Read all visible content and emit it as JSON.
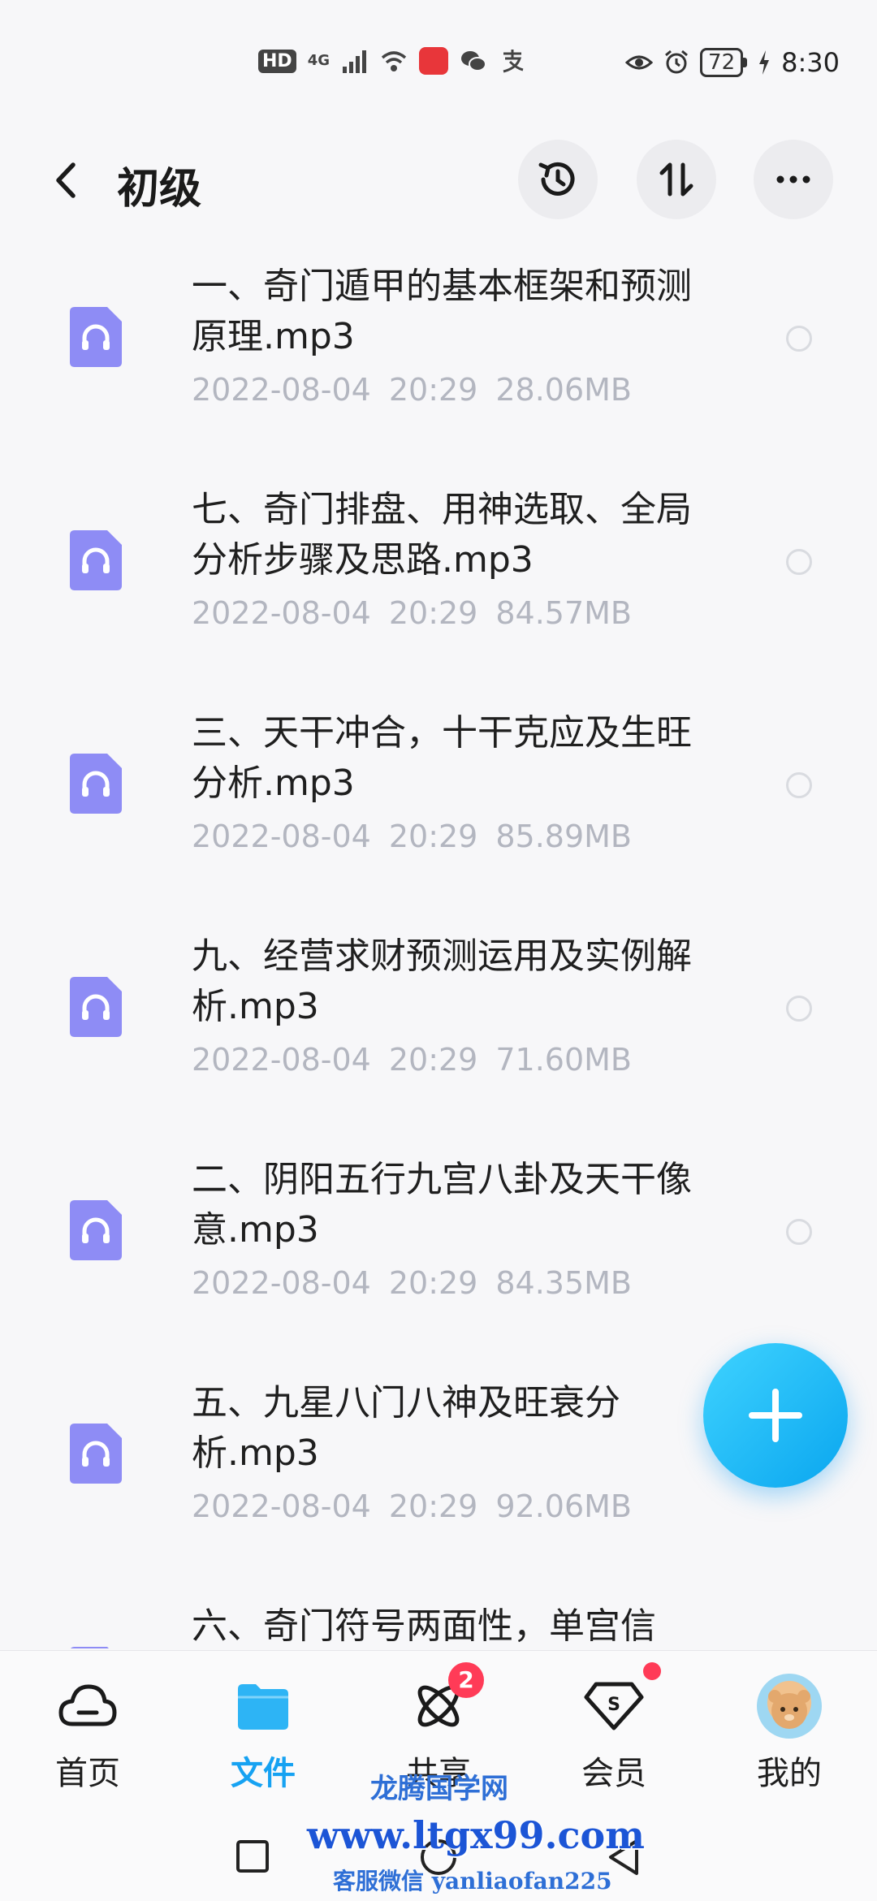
{
  "status_bar": {
    "hd_label": "HD",
    "network": "4G",
    "battery": "72",
    "time": "8:30"
  },
  "header": {
    "title": "初级"
  },
  "files": [
    {
      "name": "一、奇门遁甲的基本框架和预测原理.mp3",
      "date": "2022-08-04",
      "time": "20:29",
      "size": "28.06MB"
    },
    {
      "name": "七、奇门排盘、用神选取、全局分析步骤及思路.mp3",
      "date": "2022-08-04",
      "time": "20:29",
      "size": "84.57MB"
    },
    {
      "name": "三、天干冲合，十干克应及生旺分析.mp3",
      "date": "2022-08-04",
      "time": "20:29",
      "size": "85.89MB"
    },
    {
      "name": "九、经营求财预测运用及实例解析.mp3",
      "date": "2022-08-04",
      "time": "20:29",
      "size": "71.60MB"
    },
    {
      "name": "二、阴阳五行九宫八卦及天干像意.mp3",
      "date": "2022-08-04",
      "time": "20:29",
      "size": "84.35MB"
    },
    {
      "name": "五、九星八门八神及旺衰分析.mp3",
      "date": "2022-08-04",
      "time": "20:29",
      "size": "92.06MB"
    },
    {
      "name": "六、奇门符号两面性，单宫信",
      "date": "",
      "time": "",
      "size": ""
    }
  ],
  "bottom_nav": {
    "items": [
      {
        "label": "首页",
        "icon": "cloud-icon"
      },
      {
        "label": "文件",
        "icon": "folder-icon",
        "active": true
      },
      {
        "label": "共享",
        "icon": "share-orbit-icon",
        "badge": "2"
      },
      {
        "label": "会员",
        "icon": "vip-diamond-icon"
      },
      {
        "label": "我的",
        "icon": "avatar"
      }
    ]
  },
  "watermark": {
    "line1": "龙腾国学网",
    "line2": "www.ltgx99.com",
    "line3": "客服微信 yanliaofan225"
  },
  "colors": {
    "accent": "#16a2f2",
    "file_icon": "#8e8cf5",
    "badge": "#ff3b57",
    "meta_text": "#b3b6c0"
  }
}
